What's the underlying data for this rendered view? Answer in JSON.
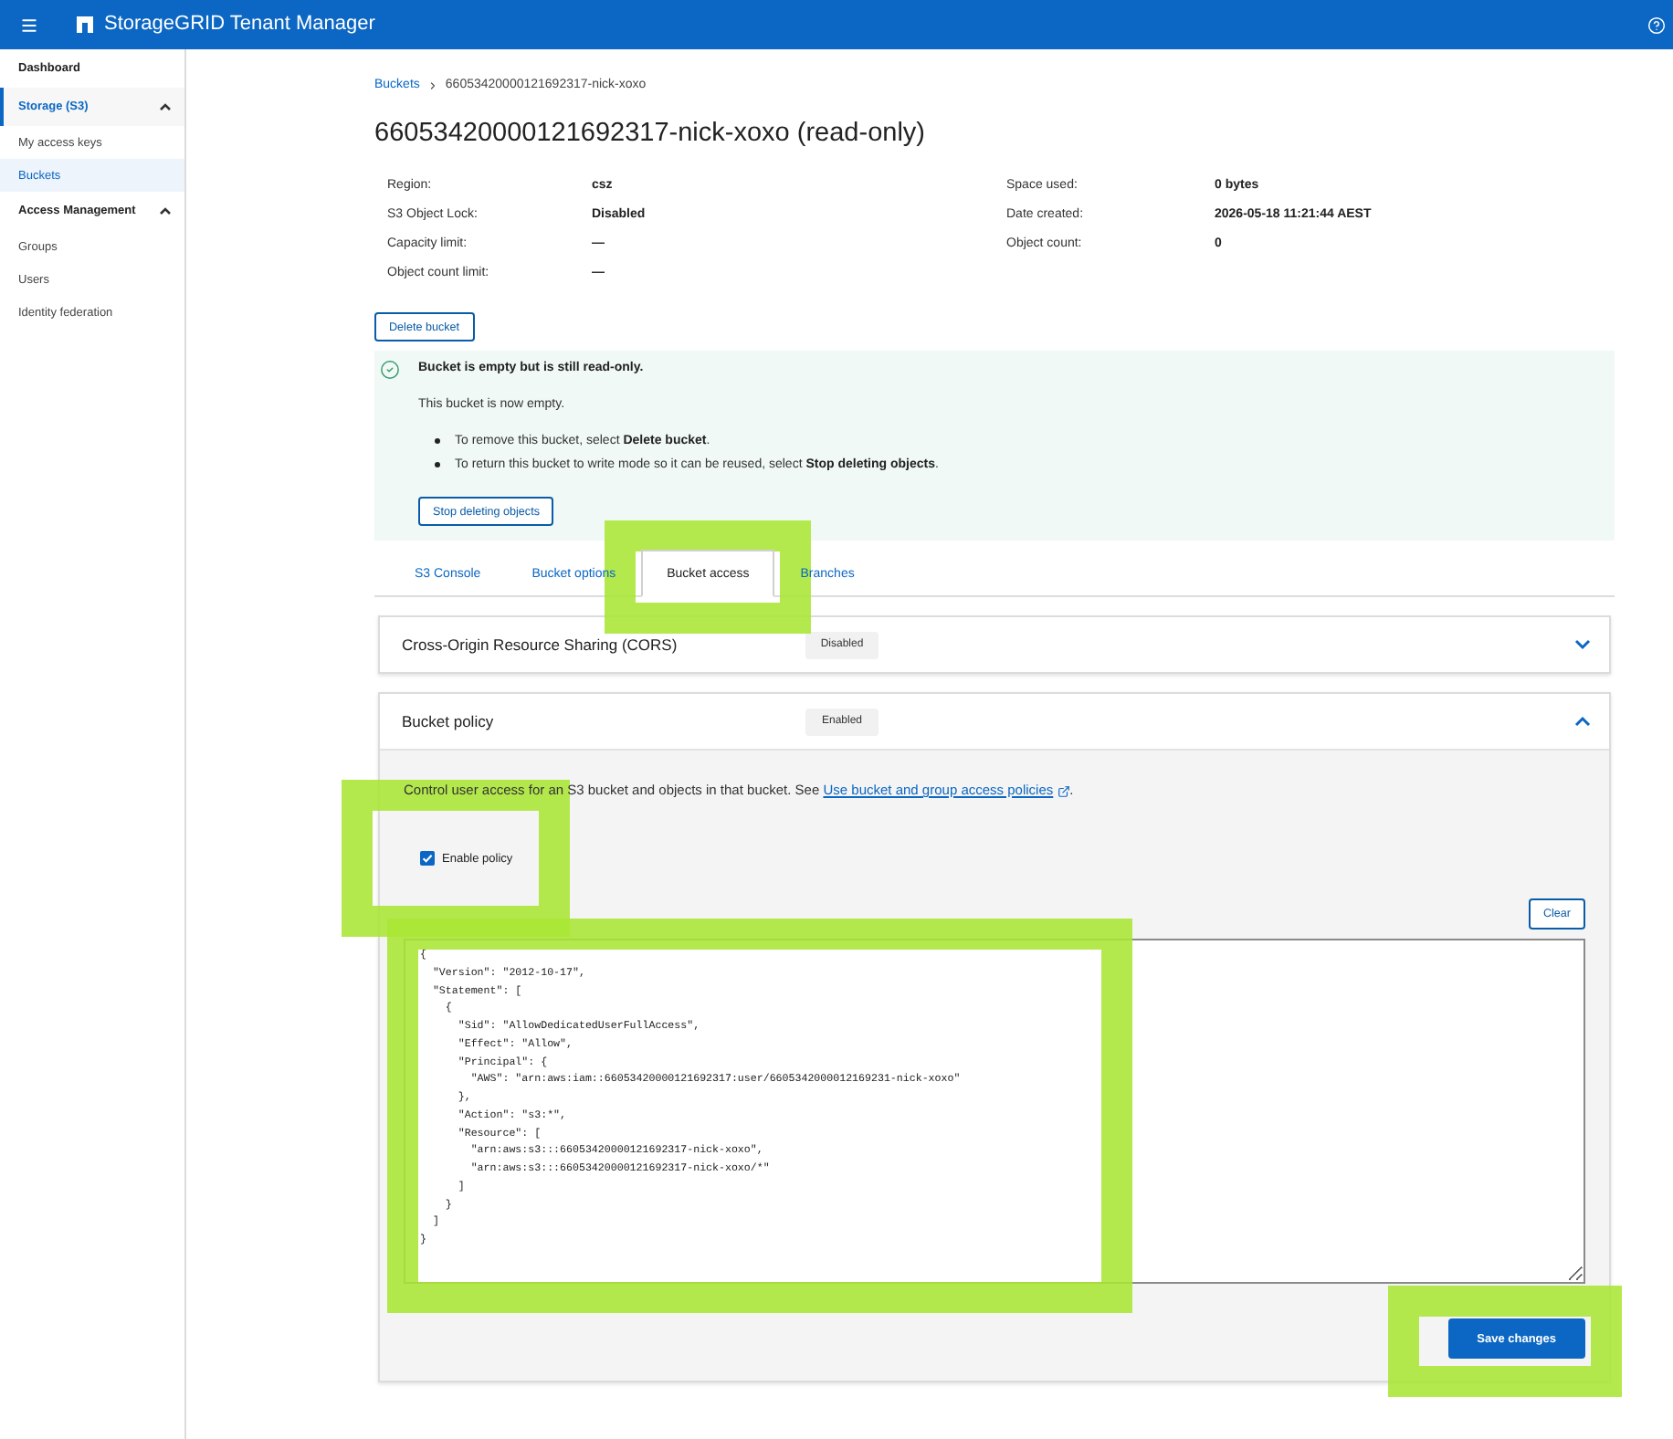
{
  "header": {
    "title": "StorageGRID Tenant Manager"
  },
  "sidebar": {
    "items": [
      {
        "label": "Dashboard",
        "kind": "link",
        "active": false
      },
      {
        "label": "Storage (S3)",
        "kind": "section",
        "active": true,
        "expanded": true,
        "children": [
          {
            "label": "My access keys",
            "selected": false
          },
          {
            "label": "Buckets",
            "selected": true
          }
        ]
      },
      {
        "label": "Access Management",
        "kind": "section",
        "active": false,
        "expanded": true,
        "children": [
          {
            "label": "Groups",
            "selected": false
          },
          {
            "label": "Users",
            "selected": false
          },
          {
            "label": "Identity federation",
            "selected": false
          }
        ]
      }
    ]
  },
  "breadcrumb": [
    {
      "label": "Buckets",
      "kind": "link"
    },
    {
      "label": "66053420000121692317-nick-xoxo",
      "kind": "current"
    }
  ],
  "title": "66053420000121692317-nick-xoxo (read-only)",
  "details": {
    "left": [
      {
        "label": "Region:",
        "value": "csz"
      },
      {
        "label": "S3 Object Lock:",
        "value": "Disabled"
      },
      {
        "label": "Capacity limit:",
        "value": "—"
      },
      {
        "label": "Object count limit:",
        "value": "—"
      }
    ],
    "right": [
      {
        "label": "Space used:",
        "value": "0 bytes"
      },
      {
        "label": "Date created:",
        "value": "2026-05-18 11:21:44 AEST"
      },
      {
        "label": "Object count:",
        "value": "0"
      }
    ]
  },
  "delete_button": "Delete bucket",
  "notice": {
    "title": "Bucket is empty but is still read-only.",
    "text": "This bucket is now empty.",
    "bullets": [
      "To remove this bucket, select **Delete bucket**.",
      "To return this bucket to write mode so it can be reused, select **Stop deleting objects**."
    ],
    "button": "Stop deleting objects"
  },
  "tabs": [
    {
      "label": "S3 Console",
      "selected": false,
      "highlighted": false
    },
    {
      "label": "Bucket options",
      "selected": false,
      "highlighted": false
    },
    {
      "label": "Bucket access",
      "selected": true,
      "highlighted": true
    },
    {
      "label": "Branches",
      "selected": false,
      "highlighted": false
    }
  ],
  "panels": [
    {
      "title": "Cross-Origin Resource Sharing (CORS)",
      "status": "Disabled",
      "expanded": false
    },
    {
      "title": "Bucket policy",
      "status": "Enabled",
      "expanded": true,
      "body": {
        "description": "Control user access for an S3 bucket and objects in that bucket. See",
        "link": "Use bucket and group access policies",
        "description_end": ".",
        "checkbox": {
          "label": "Enable policy",
          "checked": true,
          "highlighted": true
        },
        "clear_button": "Clear",
        "editor": {
          "value": "{\n  \"Version\": \"2012-10-17\",\n  \"Statement\": [\n    {\n      \"Sid\": \"AllowDedicatedUserFullAccess\",\n      \"Effect\": \"Allow\",\n      \"Principal\": {\n        \"AWS\": \"arn:aws:iam::66053420000121692317:user/6605342000012169231-nick-xoxo\"\n      },\n      \"Action\": \"s3:*\",\n      \"Resource\": [\n        \"arn:aws:s3:::66053420000121692317-nick-xoxo\",\n        \"arn:aws:s3:::66053420000121692317-nick-xoxo/*\"\n      ]\n    }\n  ]\n}",
          "highlighted": true
        },
        "save_button": {
          "label": "Save changes",
          "highlighted": true
        }
      }
    }
  ]
}
